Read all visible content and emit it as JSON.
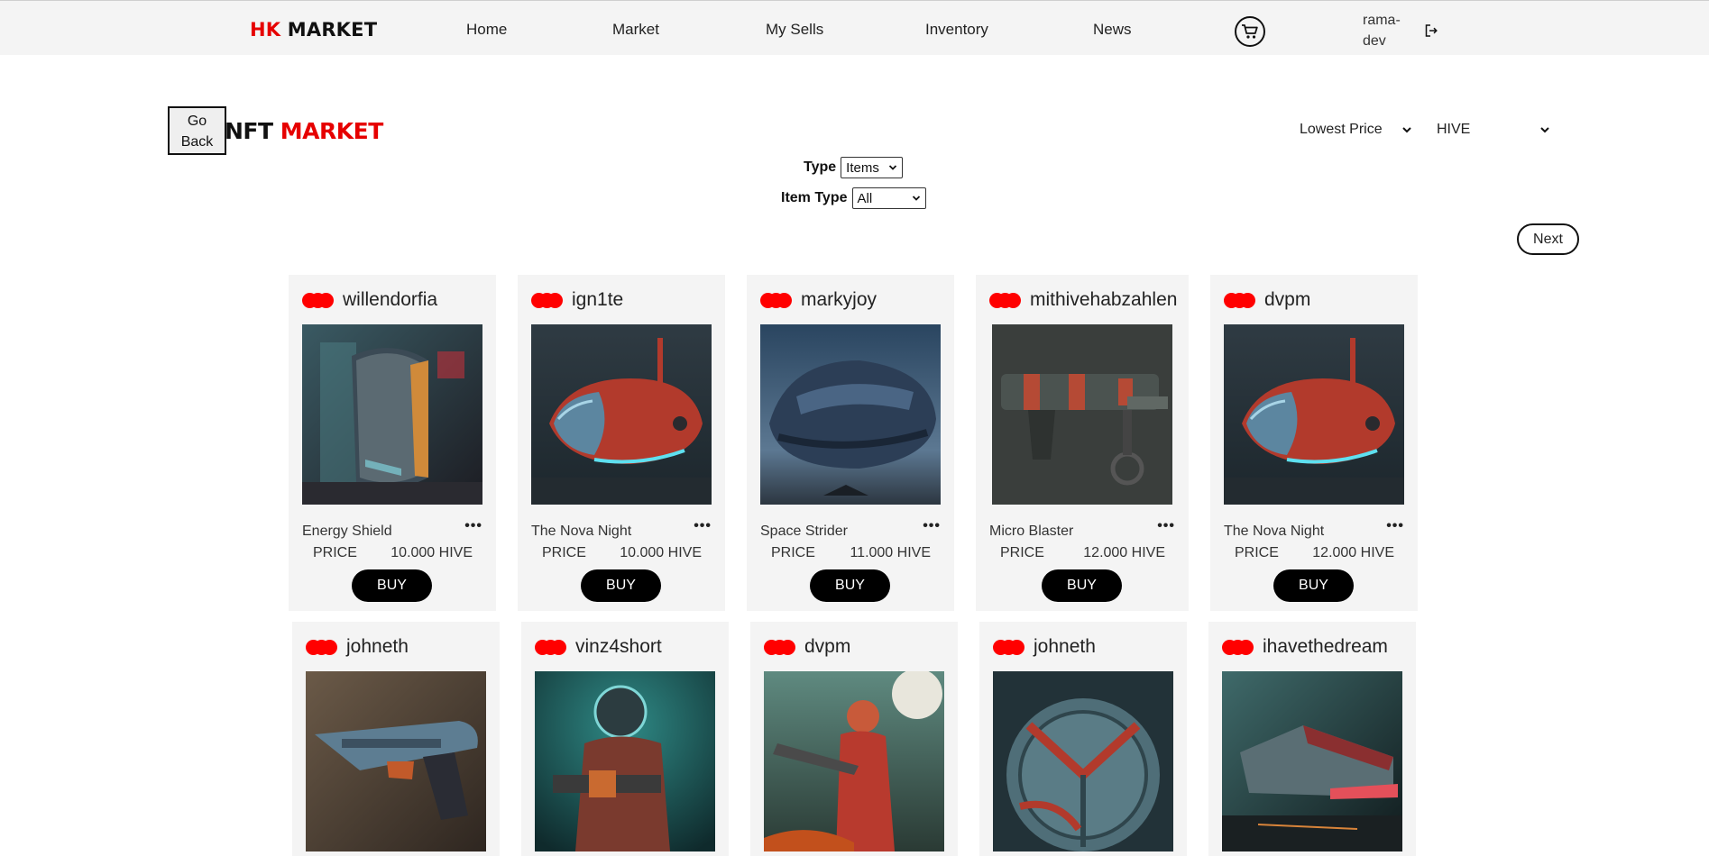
{
  "nav": {
    "logo_hk": "HK",
    "logo_market": "MARKET",
    "links": [
      "Home",
      "Market",
      "My Sells",
      "Inventory",
      "News"
    ],
    "cart_icon": "cart-icon",
    "user": "rama-dev",
    "user_line1": "rama-",
    "user_line2": "dev",
    "logout_icon": "logout-icon"
  },
  "header": {
    "go_back_line1": "Go",
    "go_back_line2": "Back",
    "title_a": "NFT",
    "title_b": "MARKET",
    "sort_value": "Lowest Price",
    "currency_value": "HIVE"
  },
  "filters": {
    "type_label": "Type",
    "type_value": "Items",
    "item_type_label": "Item Type",
    "item_type_value": "All"
  },
  "pagination": {
    "next_label": "Next"
  },
  "colors": {
    "accent": "#e60000",
    "card_bg": "#f4f4f4",
    "button": "#000000"
  },
  "cards_row1": [
    {
      "seller": "willendorfia",
      "name": "Energy Shield",
      "price_label": "PRICE",
      "price": "10.000 HIVE",
      "buy": "BUY",
      "image": "energy-shield-image"
    },
    {
      "seller": "ign1te",
      "name": "The Nova Night",
      "price_label": "PRICE",
      "price": "10.000 HIVE",
      "buy": "BUY",
      "image": "nova-night-ship-image"
    },
    {
      "seller": "markyjoy",
      "name": "Space Strider",
      "price_label": "PRICE",
      "price": "11.000 HIVE",
      "buy": "BUY",
      "image": "space-strider-ship-image"
    },
    {
      "seller": "mithivehabzahlen",
      "name": "Micro Blaster",
      "price_label": "PRICE",
      "price": "12.000 HIVE",
      "buy": "BUY",
      "image": "micro-blaster-image"
    },
    {
      "seller": "dvpm",
      "name": "The Nova Night",
      "price_label": "PRICE",
      "price": "12.000 HIVE",
      "buy": "BUY",
      "image": "nova-night-ship-image"
    }
  ],
  "cards_row2": [
    {
      "seller": "johneth",
      "image": "blaster-pistol-image"
    },
    {
      "seller": "vinz4short",
      "image": "space-soldier-image"
    },
    {
      "seller": "dvpm",
      "image": "red-coat-gunner-image"
    },
    {
      "seller": "johneth",
      "image": "round-shield-image"
    },
    {
      "seller": "ihavethedream",
      "image": "hover-car-image"
    }
  ]
}
